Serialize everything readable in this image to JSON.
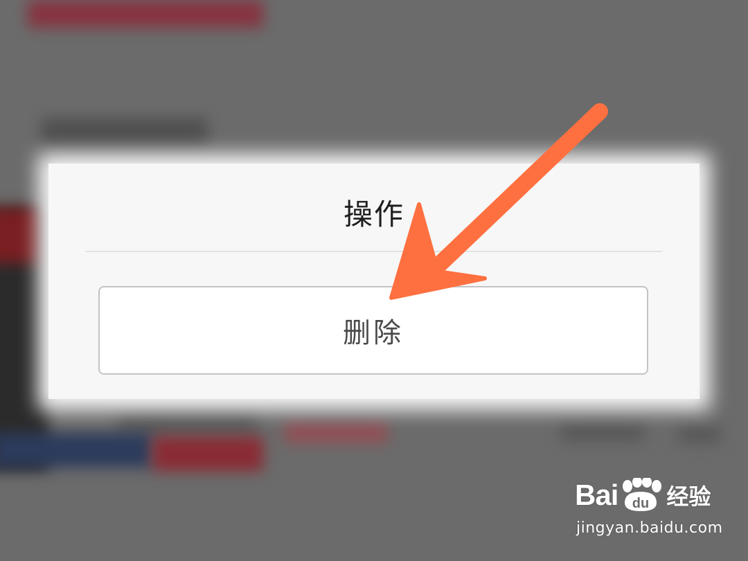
{
  "dialog": {
    "title": "操作",
    "delete_label": "删除"
  },
  "annotation": {
    "arrow_color": "#ff7040"
  },
  "watermark": {
    "brand_left": "Bai",
    "paw_text": "du",
    "brand_cn": "经验",
    "url": "jingyan.baidu.com"
  },
  "colors": {
    "overlay": "#6b6b6b",
    "dialog_bg": "#f7f7f7",
    "button_border": "#c3c3c3",
    "arrow": "#ff7040"
  }
}
